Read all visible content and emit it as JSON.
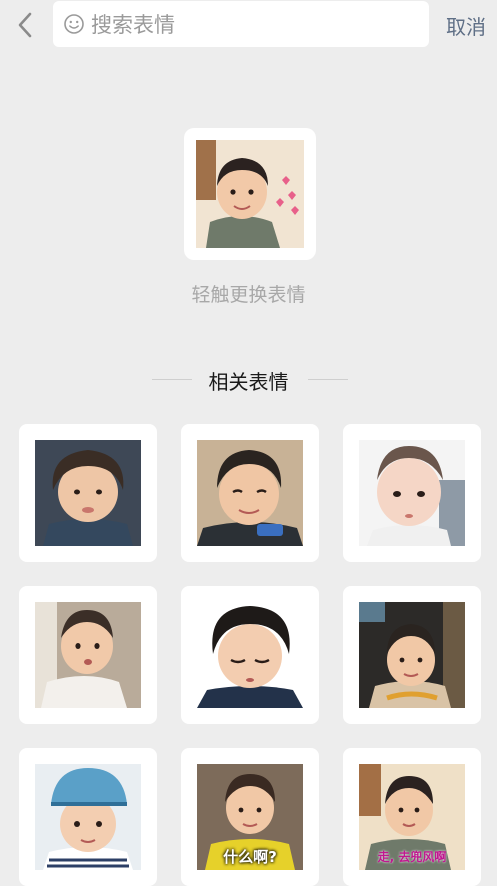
{
  "search": {
    "placeholder": "搜索表情",
    "value": ""
  },
  "header": {
    "cancel_label": "取消"
  },
  "preview": {
    "hint": "轻触更换表情"
  },
  "related": {
    "title": "相关表情",
    "captions": [
      "什么啊?",
      "走, 去兜风啊"
    ]
  },
  "colors": {
    "background": "#ededed",
    "card": "#ffffff",
    "link": "#5f6f86",
    "hint": "#a8a8a8"
  },
  "icons": [
    "back-arrow-icon",
    "smiley-icon"
  ]
}
